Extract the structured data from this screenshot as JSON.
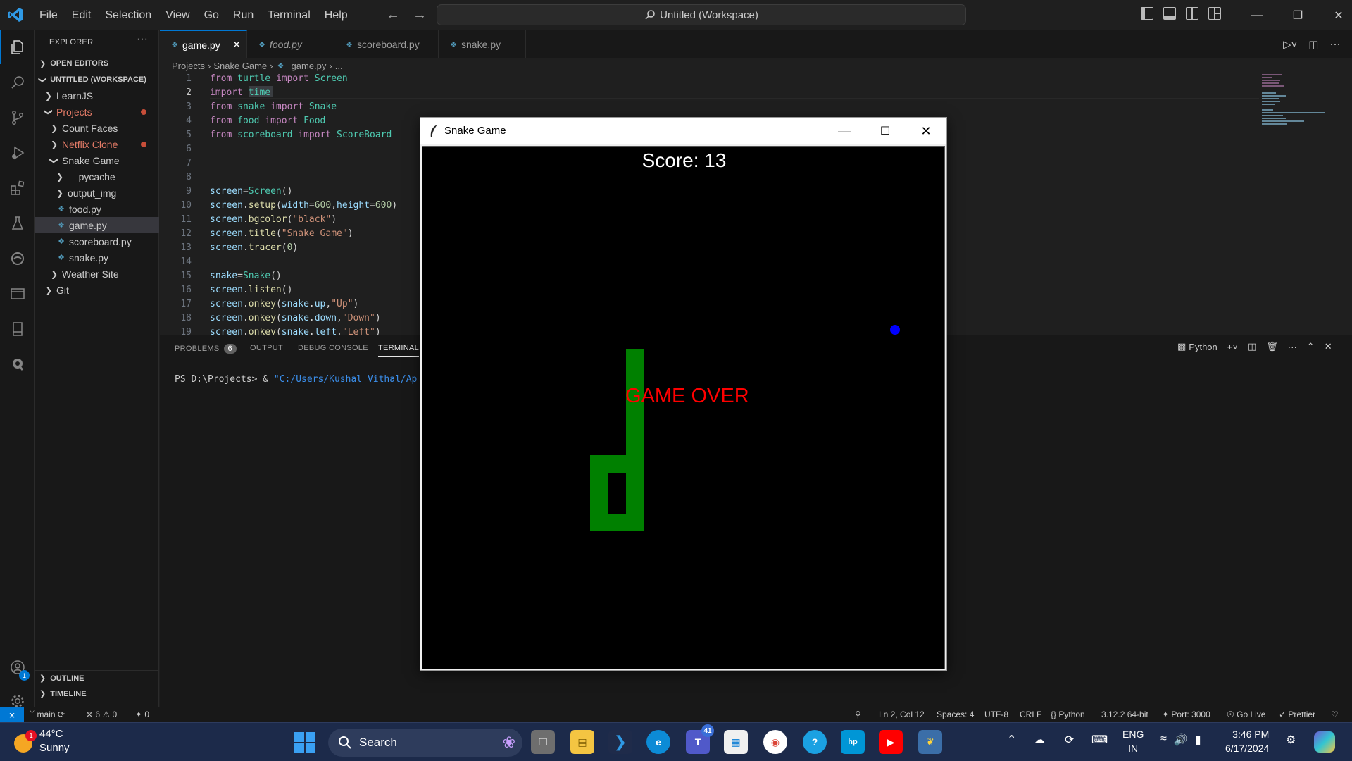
{
  "titlebar": {
    "menu": [
      "File",
      "Edit",
      "Selection",
      "View",
      "Go",
      "Run",
      "Terminal",
      "Help"
    ],
    "search": "Untitled (Workspace)"
  },
  "sidebar": {
    "title": "EXPLORER",
    "open_editors": "OPEN EDITORS",
    "workspace": "UNTITLED (WORKSPACE)",
    "items": [
      "LearnJS",
      "Projects",
      "Count Faces",
      "Netflix Clone",
      "Snake Game",
      "__pycache__",
      "output_img",
      "food.py",
      "game.py",
      "scoreboard.py",
      "snake.py",
      "Weather Site",
      "Git"
    ],
    "outline": "OUTLINE",
    "timeline": "TIMELINE"
  },
  "tabs": [
    "game.py",
    "food.py",
    "scoreboard.py",
    "snake.py"
  ],
  "breadcrumb": [
    "Projects",
    "Snake Game",
    "game.py",
    "..."
  ],
  "editor": {
    "line_numbers": [
      "1",
      "2",
      "3",
      "4",
      "5",
      "6",
      "7",
      "8",
      "9",
      "10",
      "11",
      "12",
      "13",
      "14",
      "15",
      "16",
      "17",
      "18",
      "19"
    ]
  },
  "panel": {
    "tabs": [
      "PROBLEMS",
      "OUTPUT",
      "DEBUG CONSOLE",
      "TERMINAL"
    ],
    "problems_count": "6",
    "terminal_prompt": "PS D:\\Projects> & ",
    "terminal_path": "\"C:/Users/Kushal Vithal/Ap",
    "shell": "Python"
  },
  "status": {
    "branch": "main",
    "errors": "6",
    "warnings": "0",
    "ports": "0",
    "position": "Ln 2, Col 12",
    "spaces": "Spaces: 4",
    "encoding": "UTF-8",
    "eol": "CRLF",
    "language": "Python",
    "interpreter": "3.12.2 64-bit",
    "port": "Port: 3000",
    "golive": "Go Live",
    "prettier": "Prettier"
  },
  "game": {
    "title": "Snake Game",
    "score": "Score: 13",
    "game_over": "GAME OVER",
    "snake_color": "#008000",
    "food_color": "#0000ff",
    "text_color": "#ff0000"
  },
  "taskbar": {
    "temp": "44°C",
    "condition": "Sunny",
    "weather_badge": "1",
    "search": "Search",
    "teams_badge": "41",
    "lang1": "ENG",
    "lang2": "IN",
    "time": "3:46 PM",
    "date": "6/17/2024",
    "account_badge": "1"
  },
  "colors": {
    "accent": "#0078d4",
    "modified": "#c74e39"
  }
}
